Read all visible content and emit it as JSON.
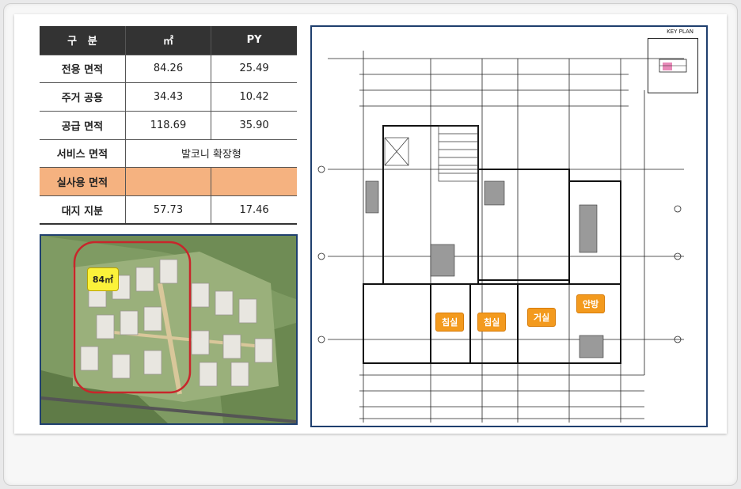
{
  "table": {
    "headers": [
      "구   분",
      "㎡",
      "PY"
    ],
    "rows": [
      {
        "label": "전용 면적",
        "sqm": "84.26",
        "py": "25.49"
      },
      {
        "label": "주거 공용",
        "sqm": "34.43",
        "py": "10.42"
      },
      {
        "label": "공급 면적",
        "sqm": "118.69",
        "py": "35.90"
      },
      {
        "label": "서비스 면적",
        "merged": "발코니 확장형"
      },
      {
        "label": "실사용 면적",
        "sqm": "",
        "py": ""
      },
      {
        "label": "대지 지분",
        "sqm": "57.73",
        "py": "17.46"
      }
    ],
    "highlight_color": "#f5b280",
    "header_color": "#333333"
  },
  "aerial": {
    "unit_tag": "84㎡",
    "highlight_color": "#c8262b"
  },
  "plan": {
    "key_plan_title": "KEY PLAN",
    "rooms": [
      "침실",
      "침실",
      "거실",
      "안방"
    ],
    "room_color": "#f39a1e"
  }
}
